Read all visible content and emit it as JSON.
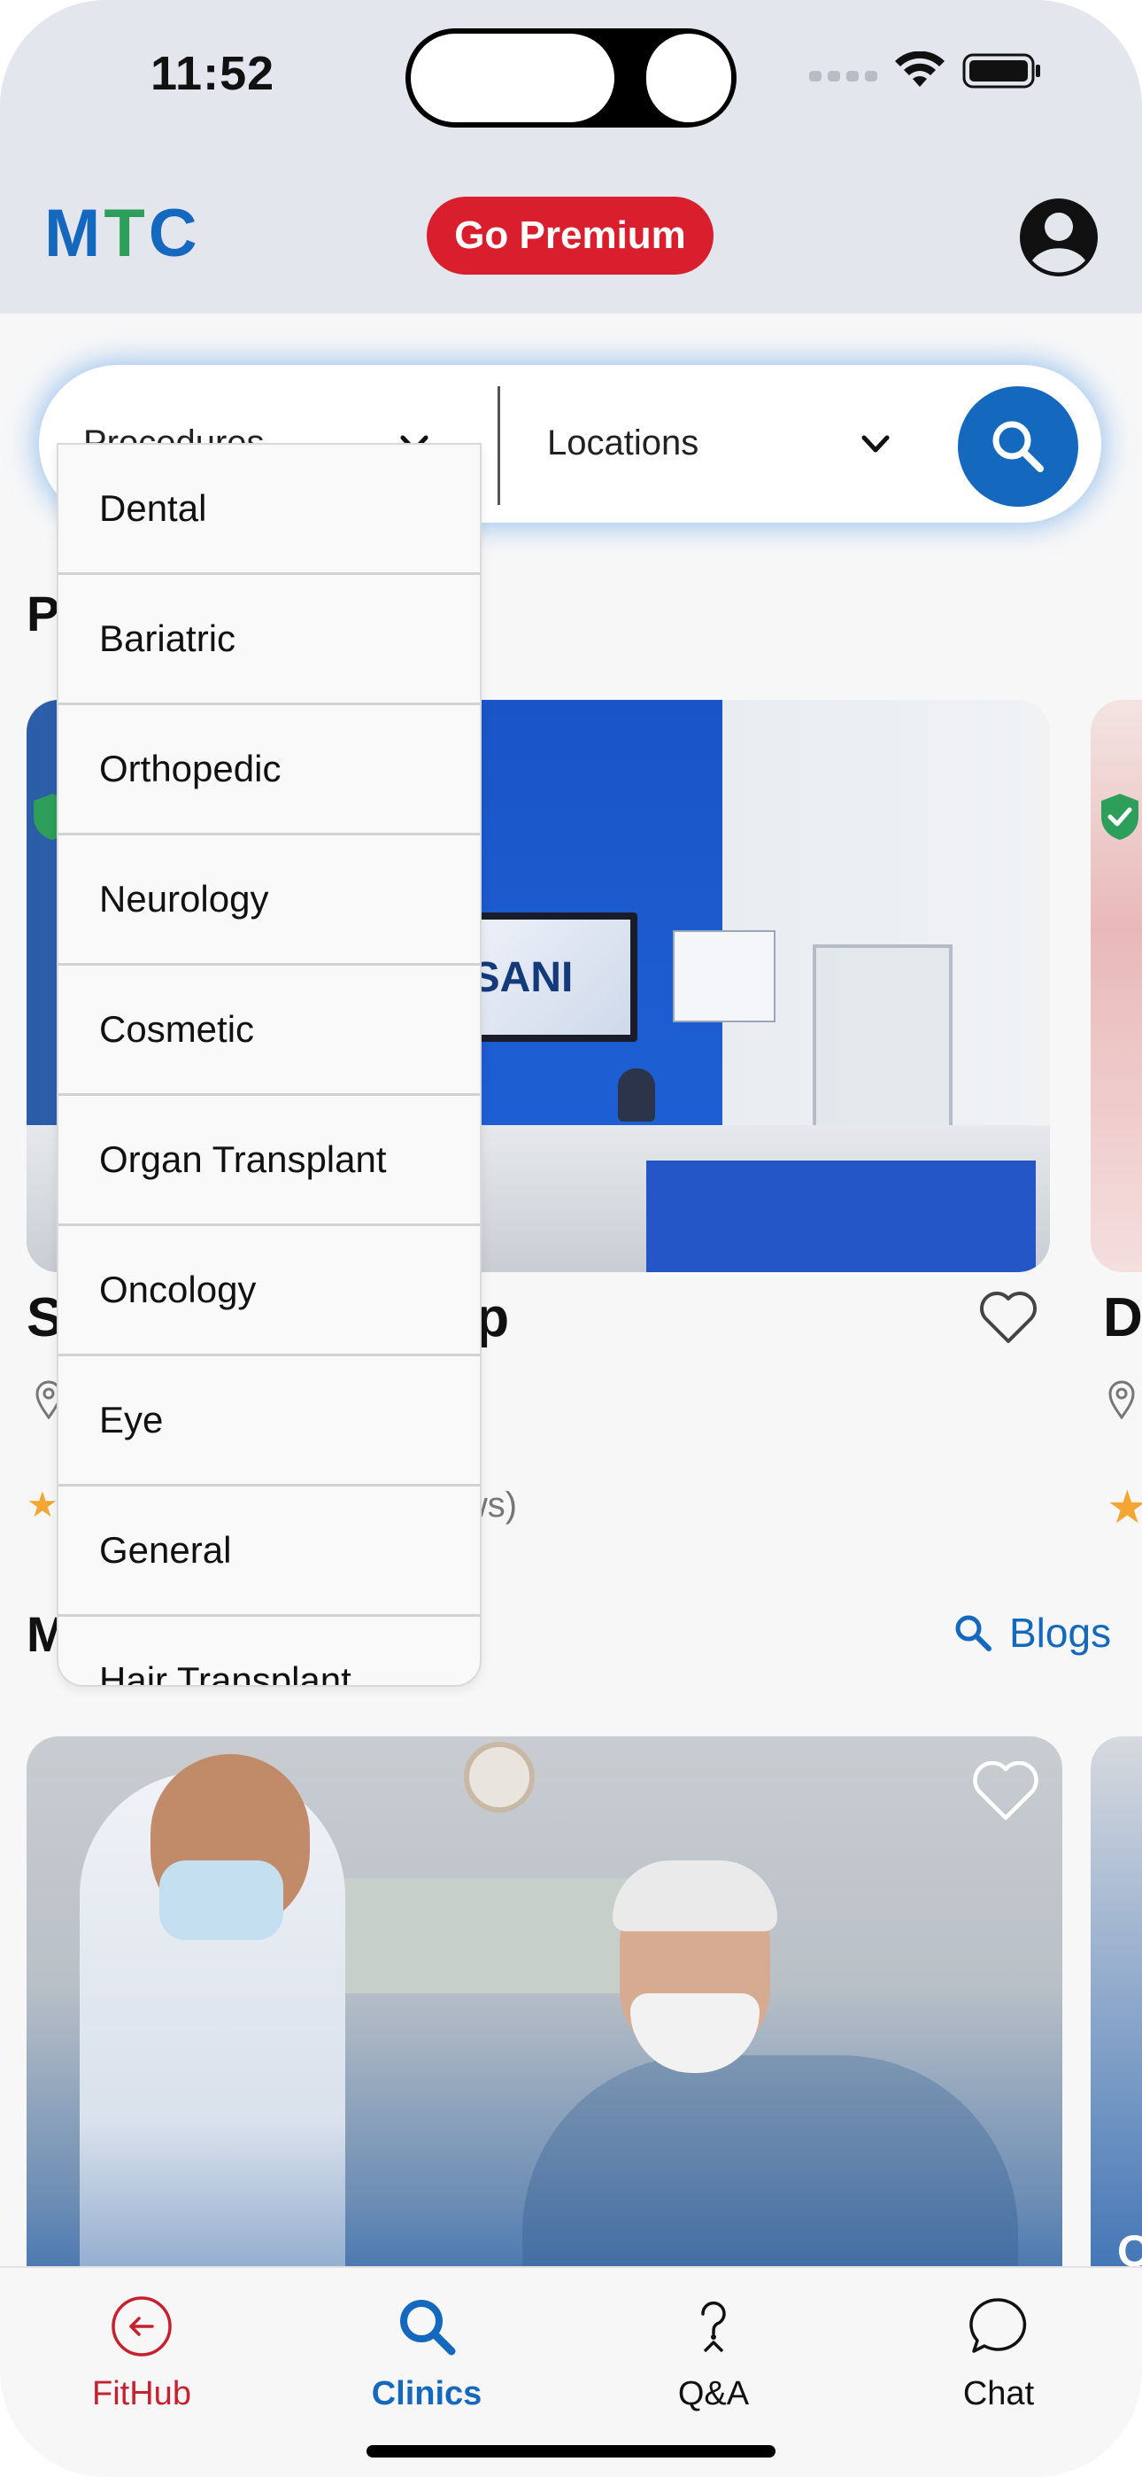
{
  "status_bar": {
    "time": "11:52"
  },
  "header": {
    "brand": {
      "m": "M",
      "t": "T",
      "c": "C"
    },
    "premium_label": "Go Premium"
  },
  "search": {
    "procedures_placeholder": "Procedures",
    "locations_placeholder": "Locations"
  },
  "procedures_dropdown": {
    "items": [
      "Dental",
      "Bariatric",
      "Orthopedic",
      "Neurology",
      "Cosmetic",
      "Organ Transplant",
      "Oncology",
      "Eye",
      "General",
      "Hair Transplant"
    ]
  },
  "clinics_section": {
    "title_visible": "P",
    "card": {
      "name_start": "S",
      "name_end": "up",
      "reviews_suffix": "ws)",
      "tv_text": "SANI"
    },
    "peek_card": {
      "name_start": "D"
    }
  },
  "blogs_section": {
    "title_visible": "M",
    "link_label": "Blogs",
    "peek_letter": "O"
  },
  "tab_bar": {
    "tabs": [
      {
        "label": "FitHub"
      },
      {
        "label": "Clinics"
      },
      {
        "label": "Q&A"
      },
      {
        "label": "Chat"
      }
    ]
  },
  "colors": {
    "primary": "#1468be",
    "brand_green": "#2e9f5a",
    "premium_red": "#d91f2d",
    "star": "#f3a632",
    "verified_green": "#2e9f5a"
  },
  "icons": [
    "wifi-icon",
    "battery-icon",
    "account-icon",
    "chevron-down-icon",
    "search-icon",
    "heart-icon",
    "location-pin-icon",
    "verified-shield-icon",
    "star-icon",
    "back-circle-icon",
    "question-icon",
    "chat-bubble-icon"
  ]
}
